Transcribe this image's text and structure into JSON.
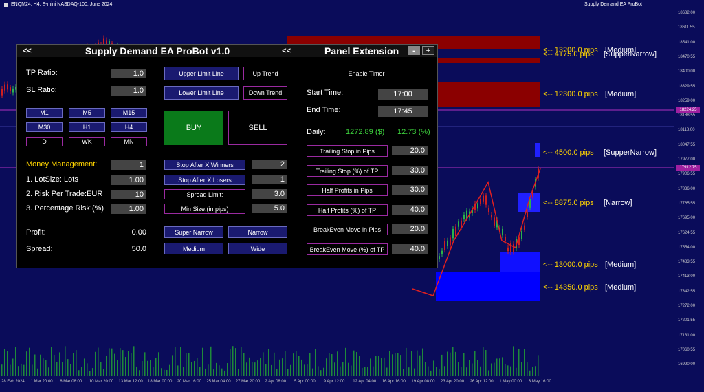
{
  "header": {
    "symbol": "ENQM24, H4:  E-mini NASDAQ-100: June 2024",
    "ea_name": "Supply Demand EA ProBot"
  },
  "price_axis": [
    "18682.00",
    "18611.55",
    "18541.00",
    "18470.55",
    "18400.00",
    "18329.55",
    "18259.00",
    "18188.55",
    "18118.00",
    "18047.55",
    "17977.00",
    "17906.55",
    "17836.00",
    "17765.55",
    "17695.00",
    "17624.55",
    "17554.00",
    "17483.55",
    "17413.00",
    "17342.55",
    "17272.00",
    "17201.55",
    "17131.00",
    "17060.55",
    "16990.00"
  ],
  "price_tags": [
    "18224.25",
    "17912.75"
  ],
  "time_axis": [
    "28 Feb 2024",
    "1 Mar 20:00",
    "6 Mar 08:00",
    "10 Mar 20:00",
    "13 Mar 12:00",
    "18 Mar 00:00",
    "20 Mar 16:00",
    "25 Mar 04:00",
    "27 Mar 20:00",
    "2 Apr 08:00",
    "5 Apr 00:00",
    "9 Apr 12:00",
    "12 Apr 04:00",
    "16 Apr 16:00",
    "19 Apr 08:00",
    "23 Apr 20:00",
    "26 Apr 12:00",
    "1 May 00:00",
    "3 May 16:00"
  ],
  "zones": [
    {
      "label": "<-- 13200.0 pips",
      "tag": "[Medium]"
    },
    {
      "label": "<-- 4175.0 pips",
      "tag": "[SupperNarrow]"
    },
    {
      "label": "<-- 12300.0 pips",
      "tag": "[Medium]"
    },
    {
      "label": "<-- 4500.0 pips",
      "tag": "[SupperNarrow]"
    },
    {
      "label": "<-- 8875.0 pips",
      "tag": "[Narrow]"
    },
    {
      "label": "<-- 13000.0 pips",
      "tag": "[Medium]"
    },
    {
      "label": "<-- 14350.0 pips",
      "tag": "[Medium]"
    }
  ],
  "panel": {
    "title": "Supply Demand EA ProBot v1.0",
    "collapse_left": "<<",
    "collapse_right": "<<",
    "tp_ratio_label": "TP Ratio:",
    "tp_ratio": "1.0",
    "sl_ratio_label": "SL Ratio:",
    "sl_ratio": "1.0",
    "upper_limit": "Upper Limit Line",
    "lower_limit": "Lower Limit Line",
    "up_trend": "Up Trend",
    "down_trend": "Down Trend",
    "timeframes": [
      "M1",
      "M5",
      "M15",
      "M30",
      "H1",
      "H4",
      "D",
      "WK",
      "MN"
    ],
    "buy": "BUY",
    "sell": "SELL",
    "money_mgmt_label": "Money Management:",
    "money_mgmt": "1",
    "lotsize_label": "1. LotSize: Lots",
    "lotsize": "1.00",
    "risk_label": "2. Risk Per Trade:EUR",
    "risk": "10",
    "pct_label": "3. Percentage Risk:(%)",
    "pct": "1.00",
    "stop_winners": "Stop After X Winners",
    "stop_winners_val": "2",
    "stop_losers": "Stop After X Losers",
    "stop_losers_val": "1",
    "spread_limit": "Spread Limit:",
    "spread_limit_val": "3.0",
    "min_size": "Min Size:(in pips)",
    "min_size_val": "5.0",
    "profit_label": "Profit:",
    "profit": "0.00",
    "spread_label": "Spread:",
    "spread": "50.0",
    "super_narrow": "Super Narrow",
    "narrow": "Narrow",
    "medium": "Medium",
    "wide": "Wide"
  },
  "extension": {
    "title": "Panel Extension",
    "minus": "-",
    "plus": "+",
    "enable_timer": "Enable Timer",
    "start_label": "Start Time:",
    "start": "17:00",
    "end_label": "End Time:",
    "end": "17:45",
    "daily_label": "Daily:",
    "daily_amount": "1272.89 ($)",
    "daily_pct": "12.73 (%)",
    "rows": [
      {
        "label": "Trailing Stop in Pips",
        "value": "20.0"
      },
      {
        "label": "Trailing Stop (%) of TP",
        "value": "30.0"
      },
      {
        "label": "Half Profits in Pips",
        "value": "30.0"
      },
      {
        "label": "Half Profits (%) of TP",
        "value": "40.0"
      },
      {
        "label": "BreakEven Move in Pips",
        "value": "20.0"
      },
      {
        "label": "BreakEven Move (%) of TP",
        "value": "40.0"
      }
    ]
  },
  "colors": {
    "background": "#0a0c5a",
    "supply": "#8b0000",
    "demand": "#1010ff",
    "accent": "#9a2aa0",
    "buy": "#0a7a1a",
    "daily": "#3ccf3c"
  }
}
